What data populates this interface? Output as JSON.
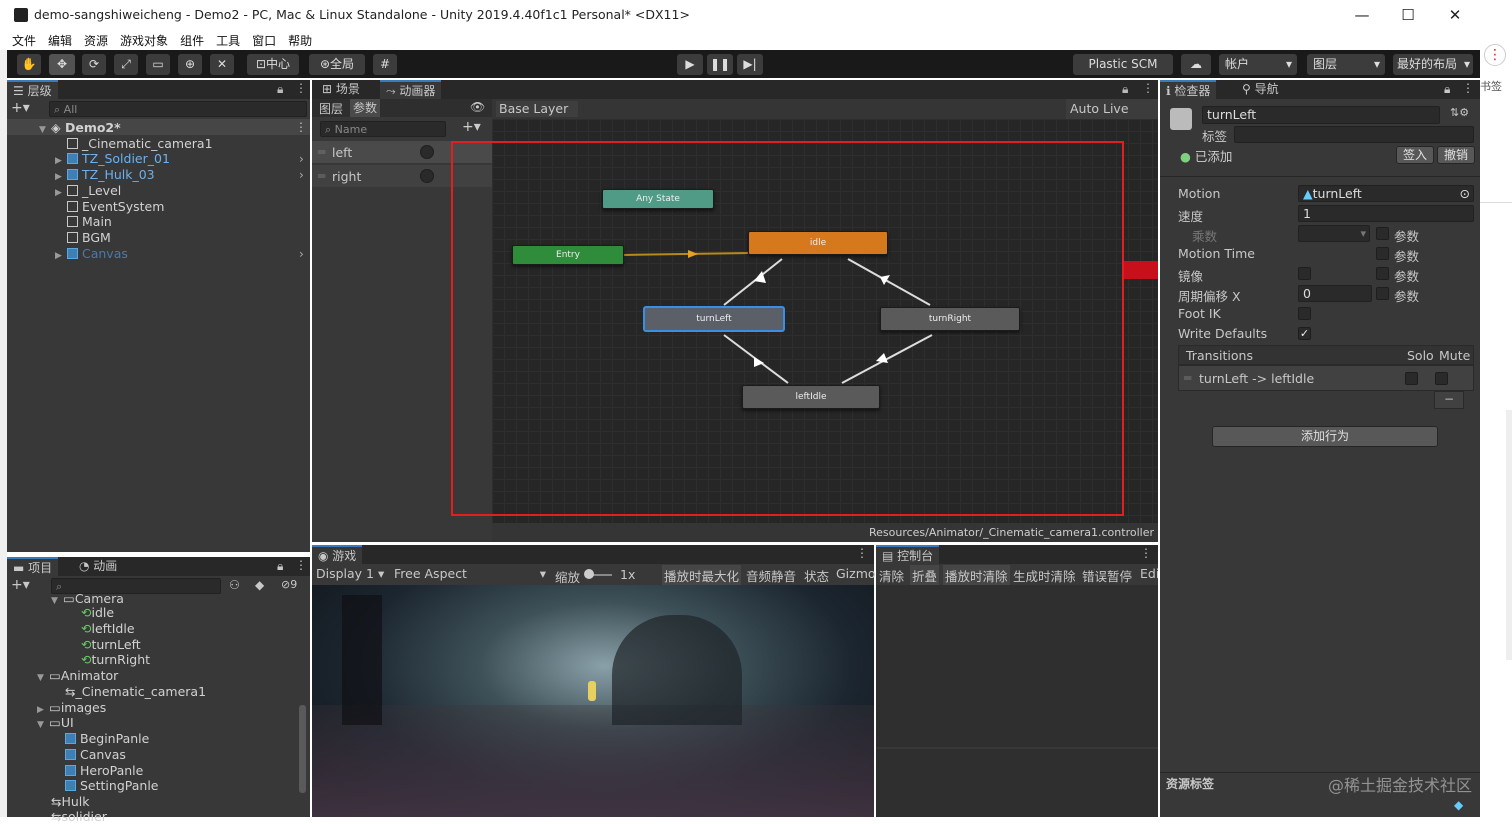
{
  "window": {
    "title": "demo-sangshiweicheng - Demo2 - PC, Mac & Linux Standalone - Unity 2019.4.40f1c1 Personal* <DX11>",
    "min": "—",
    "max": "☐",
    "close": "✕"
  },
  "menu": [
    "文件",
    "编辑",
    "资源",
    "游戏对象",
    "组件",
    "工具",
    "窗口",
    "帮助"
  ],
  "toolbar": {
    "pivot": "中心",
    "global": "全局",
    "plastic": "Plastic SCM",
    "account": "帐户",
    "layers": "图层",
    "layout": "最好的布局"
  },
  "hierarchy": {
    "tab": "层级",
    "search_placeholder": "All",
    "scene": "Demo2*",
    "items": [
      "_Cinematic_camera1",
      "TZ_Soldier_01",
      "TZ_Hulk_03",
      "_Level",
      "EventSystem",
      "Main",
      "BGM",
      "Canvas"
    ]
  },
  "animator": {
    "tab_scene": "场景",
    "tab_animator": "动画器",
    "tab_layers": "图层",
    "tab_params": "参数",
    "base_layer": "Base Layer",
    "auto_live_link": "Auto Live Link",
    "name_placeholder": "Name",
    "params": [
      "left",
      "right"
    ],
    "states": {
      "any": "Any State",
      "entry": "Entry",
      "idle": "idle",
      "turnLeft": "turnLeft",
      "turnRight": "turnRight",
      "leftIdle": "leftIdle"
    },
    "path": "Resources/Animator/_Cinematic_camera1.controller"
  },
  "project": {
    "tab_project": "项目",
    "tab_anim": "动画",
    "hidden_count": "9",
    "items": [
      "Camera",
      "idle",
      "leftIdle",
      "turnLeft",
      "turnRight",
      "Animator",
      "_Cinematic_camera1",
      "images",
      "UI",
      "BeginPanle",
      "Canvas",
      "HeroPanle",
      "SettingPanle",
      "Hulk",
      "solidier"
    ]
  },
  "game": {
    "tab": "游戏",
    "display": "Display 1",
    "aspect": "Free Aspect",
    "zoom_label": "缩放",
    "zoom_value": "1x",
    "maximize": "播放时最大化",
    "mute": "音频静音",
    "stats": "状态",
    "gizmos": "Gizmo"
  },
  "console": {
    "tab": "控制台",
    "clear": "清除",
    "collapse": "折叠",
    "clear_on_play": "播放时清除",
    "clear_on_build": "生成时清除",
    "error_pause": "错误暂停",
    "editor": "Edi"
  },
  "inspector": {
    "tab": "检查器",
    "tab_nav": "导航",
    "name": "turnLeft",
    "tag_label": "标签",
    "added": "已添加",
    "checkin": "签入",
    "revert": "撤销",
    "rows": [
      {
        "label": "Motion",
        "value": "turnLeft"
      },
      {
        "label": "速度",
        "value": "1"
      },
      {
        "label": "乘数",
        "value": ""
      },
      {
        "label": "Motion Time",
        "value": ""
      },
      {
        "label": "镜像",
        "value": ""
      },
      {
        "label": "周期偏移 X",
        "value": "0"
      },
      {
        "label": "Foot IK",
        "value": ""
      },
      {
        "label": "Write Defaults",
        "value": ""
      }
    ],
    "param": "参数",
    "transitions_header": "Transitions",
    "solo": "Solo",
    "mute": "Mute",
    "transition": "turnLeft -> leftIdle",
    "add_behaviour": "添加行为",
    "asset_labels": "资源标签"
  },
  "watermark": "@稀土掘金技术社区",
  "side_text": "书签"
}
